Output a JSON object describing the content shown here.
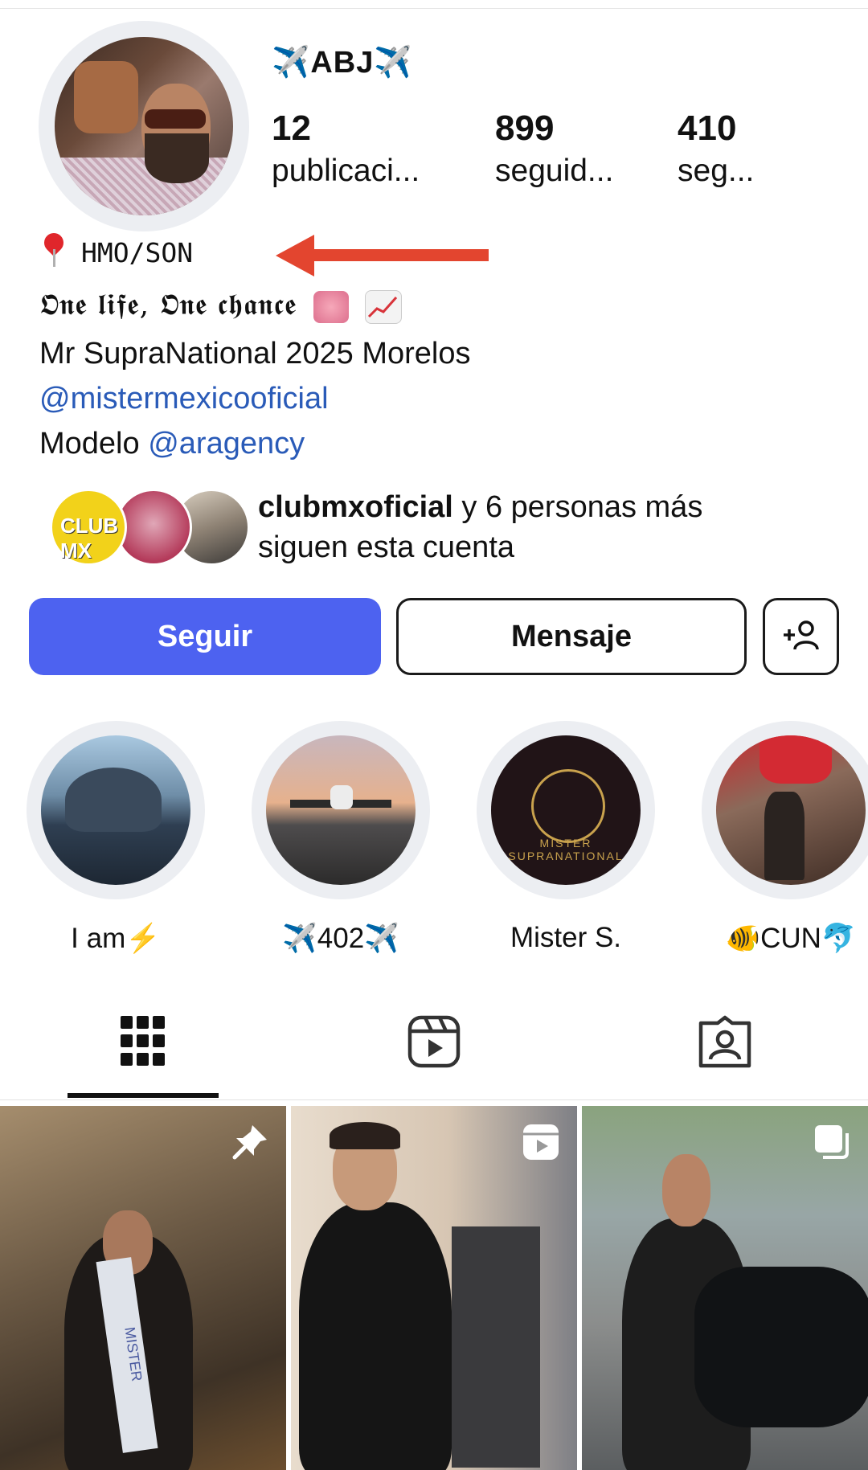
{
  "profile": {
    "username": "✈️ABJ✈️",
    "stats": [
      {
        "value": "12",
        "label": "publicaci..."
      },
      {
        "value": "899",
        "label": "seguid..."
      },
      {
        "value": "410",
        "label": "seg..."
      }
    ],
    "location": "HMO/SON",
    "bio": {
      "line1": "𝕺𝖓𝖊 𝖑𝖎𝖋𝖊, 𝕺𝖓𝖊 𝖈𝖍𝖆𝖓𝖈𝖊",
      "line2": "Mr SupraNational 2025 Morelos",
      "line3_link": "@mistermexicooficial",
      "line4_prefix": "Modelo ",
      "line4_link": "@aragency"
    }
  },
  "followed_by": {
    "account": "clubmxoficial",
    "rest": " y 6 personas más",
    "line2": "siguen esta cuenta",
    "avatar1_text": "CLUB MX"
  },
  "actions": {
    "follow_label": "Seguir",
    "message_label": "Mensaje",
    "add_icon": "add-person-icon"
  },
  "highlights": [
    {
      "label": "I am⚡"
    },
    {
      "label": "✈️402✈️"
    },
    {
      "label": "Mister S."
    },
    {
      "label": "🐠CUN🐬"
    }
  ],
  "highlight3_logo_text": "MISTER SUPRANATIONAL",
  "tabs": [
    "grid-icon",
    "reels-icon",
    "tagged-icon"
  ],
  "posts": [
    {
      "badge": "pin-icon",
      "sash_text": "MISTER"
    },
    {
      "badge": "reel-icon"
    },
    {
      "badge": "carousel-icon"
    }
  ],
  "colors": {
    "accent": "#4d62f0",
    "link": "#2a5bb8",
    "annotation_arrow": "#e3452f"
  }
}
